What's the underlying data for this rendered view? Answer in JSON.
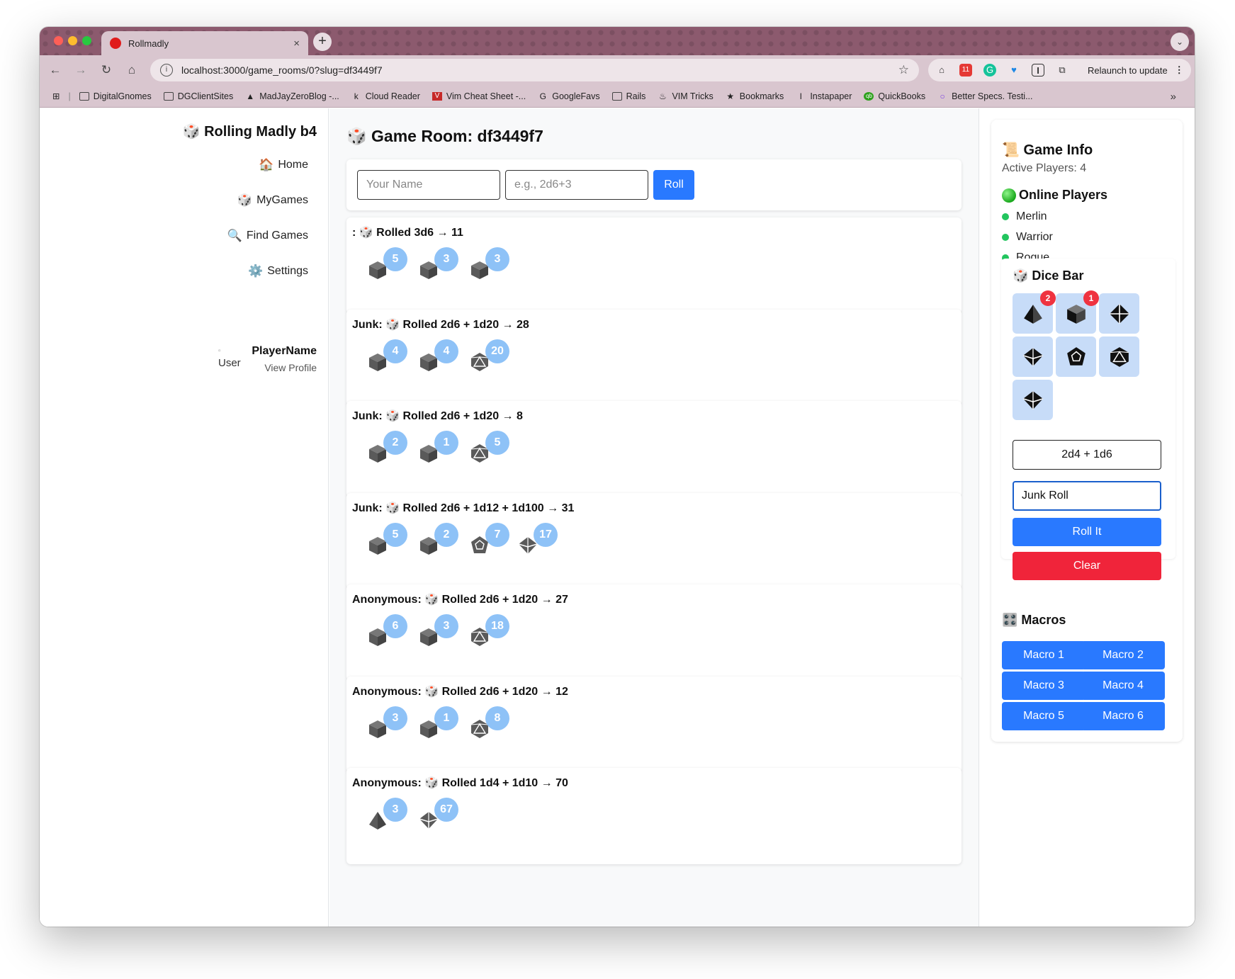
{
  "browser": {
    "tab_title": "Rollmadly",
    "tab_close": "×",
    "new_tab": "+",
    "url": "localhost:3000/game_rooms/0?slug=df3449f7",
    "relaunch": "Relaunch to update",
    "bookmarks": [
      {
        "label": "DigitalGnomes",
        "icon": "folder-icon"
      },
      {
        "label": "DGClientSites",
        "icon": "folder-icon"
      },
      {
        "label": "MadJayZeroBlog -...",
        "icon": "drive-icon"
      },
      {
        "label": "Cloud Reader",
        "icon": "kindle-icon"
      },
      {
        "label": "Vim Cheat Sheet -...",
        "icon": "vim-icon"
      },
      {
        "label": "GoogleFavs",
        "icon": "google-icon"
      },
      {
        "label": "Rails",
        "icon": "folder-icon"
      },
      {
        "label": "VIM Tricks",
        "icon": "flame-icon"
      },
      {
        "label": "Bookmarks",
        "icon": "star-icon"
      },
      {
        "label": "Instapaper",
        "icon": "instapaper-icon"
      },
      {
        "label": "QuickBooks",
        "icon": "quickbooks-icon"
      },
      {
        "label": "Better Specs. Testi...",
        "icon": "circle-icon"
      }
    ]
  },
  "sidebar": {
    "brand": "🎲 Rolling Madly b4",
    "nav": [
      {
        "emoji": "🏠",
        "label": "Home"
      },
      {
        "emoji": "🎲",
        "label": "MyGames"
      },
      {
        "emoji": "🔍",
        "label": "Find Games"
      },
      {
        "emoji": "⚙️",
        "label": "Settings"
      }
    ],
    "user_avatar_alt": "User",
    "user_name": "PlayerName",
    "view_profile": "View Profile"
  },
  "main": {
    "title": "🎲 Game Room: df3449f7",
    "name_placeholder": "Your Name",
    "dice_placeholder": "e.g., 2d6+3",
    "roll_label": "Roll",
    "rolls": [
      {
        "prefix": ":",
        "text": "Rolled 3d6 → 11",
        "dice": [
          {
            "type": "d6",
            "value": "5"
          },
          {
            "type": "d6",
            "value": "3"
          },
          {
            "type": "d6",
            "value": "3"
          }
        ]
      },
      {
        "prefix": "Junk:",
        "text": "Rolled 2d6 + 1d20 → 28",
        "dice": [
          {
            "type": "d6",
            "value": "4"
          },
          {
            "type": "d6",
            "value": "4"
          },
          {
            "type": "d20",
            "value": "20"
          }
        ]
      },
      {
        "prefix": "Junk:",
        "text": "Rolled 2d6 + 1d20 → 8",
        "dice": [
          {
            "type": "d6",
            "value": "2"
          },
          {
            "type": "d6",
            "value": "1"
          },
          {
            "type": "d20",
            "value": "5"
          }
        ]
      },
      {
        "prefix": "Junk:",
        "text": "Rolled 2d6 + 1d12 + 1d100 → 31",
        "dice": [
          {
            "type": "d6",
            "value": "5"
          },
          {
            "type": "d6",
            "value": "2"
          },
          {
            "type": "d12",
            "value": "7"
          },
          {
            "type": "d10",
            "value": "17"
          }
        ]
      },
      {
        "prefix": "Anonymous:",
        "text": "Rolled 2d6 + 1d20 → 27",
        "dice": [
          {
            "type": "d6",
            "value": "6"
          },
          {
            "type": "d6",
            "value": "3"
          },
          {
            "type": "d20",
            "value": "18"
          }
        ]
      },
      {
        "prefix": "Anonymous:",
        "text": "Rolled 2d6 + 1d20 → 12",
        "dice": [
          {
            "type": "d6",
            "value": "3"
          },
          {
            "type": "d6",
            "value": "1"
          },
          {
            "type": "d20",
            "value": "8"
          }
        ]
      },
      {
        "prefix": "Anonymous:",
        "text": "Rolled 1d4 + 1d10 → 70",
        "dice": [
          {
            "type": "d4",
            "value": "3"
          },
          {
            "type": "d10",
            "value": "67"
          }
        ]
      }
    ]
  },
  "game_info": {
    "title": "📜 Game Info",
    "active_players": "Active Players: 4",
    "online_title": "Online Players",
    "players": [
      "Merlin",
      "Warrior",
      "Rogue"
    ],
    "dicebar_title": "🎲 Dice Bar",
    "dice_buttons": [
      {
        "die": "d4",
        "count": "2"
      },
      {
        "die": "d6",
        "count": "1"
      },
      {
        "die": "d8",
        "count": ""
      },
      {
        "die": "d10",
        "count": ""
      },
      {
        "die": "d12",
        "count": ""
      },
      {
        "die": "d20",
        "count": ""
      },
      {
        "die": "d100",
        "count": ""
      }
    ],
    "expression": "2d4 + 1d6",
    "label_value": "Junk Roll",
    "roll_it": "Roll It",
    "clear": "Clear",
    "macros_title": "🎛️ Macros",
    "macros": [
      "Macro 1",
      "Macro 2",
      "Macro 3",
      "Macro 4",
      "Macro 5",
      "Macro 6"
    ]
  },
  "colors": {
    "primary": "#2979ff",
    "danger": "#f0243a",
    "badge": "#8ec2f7",
    "dice_btn_bg": "#c7dcf8",
    "online": "#22c55e"
  }
}
